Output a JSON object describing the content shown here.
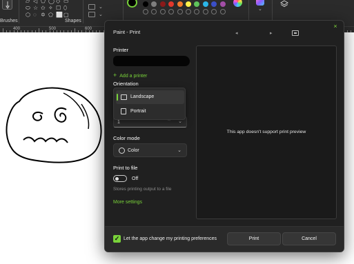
{
  "ribbon": {
    "brushes_label": "Brushes",
    "shapes_label": "Shapes",
    "shape_glyphs": [
      "▱",
      "◁",
      "⬠",
      "◯",
      "◇",
      "▭",
      "⬭",
      "☆",
      "✩",
      "✧",
      "☐",
      "⬯",
      "⬡",
      "◌",
      "✡",
      "⬠",
      "⬜",
      "▢"
    ],
    "palette": [
      "#000000",
      "#7f7f7f",
      "#8b1a1a",
      "#e3382c",
      "#f37b2d",
      "#fff14a",
      "#5fc25b",
      "#2bb5e8",
      "#3b4fc7",
      "#a34ea6",
      "#ffffff",
      "#c3c3c3",
      "#b97a57",
      "#f4a8c4",
      "#ffc90e",
      "#efe4b0",
      "#b5e61d",
      "#99d9ea",
      "#7092be",
      "#c8bfe7"
    ]
  },
  "ruler": {
    "marks": [
      "400",
      "500",
      "600"
    ]
  },
  "dialog": {
    "title": "Paint - Print",
    "close_icon": "×",
    "prev_icon": "◂",
    "next_icon": "▸",
    "fit_icon": "⛶",
    "printer_label": "Printer",
    "add_printer_label": "Add a printer",
    "orientation_label": "Orientation",
    "orientation_options": [
      "Landscape",
      "Portrait"
    ],
    "orientation_selected": "Landscape",
    "copies_value": "1",
    "color_mode_label": "Color mode",
    "color_mode_value": "Color",
    "print_to_file_label": "Print to file",
    "print_to_file_state": "Off",
    "print_to_file_help": "Stores printing output to a file",
    "more_settings_label": "More settings",
    "preview_message": "This app doesn't support print preview",
    "let_app_change_label": "Let the app change my printing preferences",
    "let_app_change_checked": true,
    "print_button": "Print",
    "cancel_button": "Cancel"
  },
  "colors": {
    "accent": "#79d23a",
    "dialog_bg": "#202020",
    "ribbon_bg": "#2b2b2b"
  }
}
